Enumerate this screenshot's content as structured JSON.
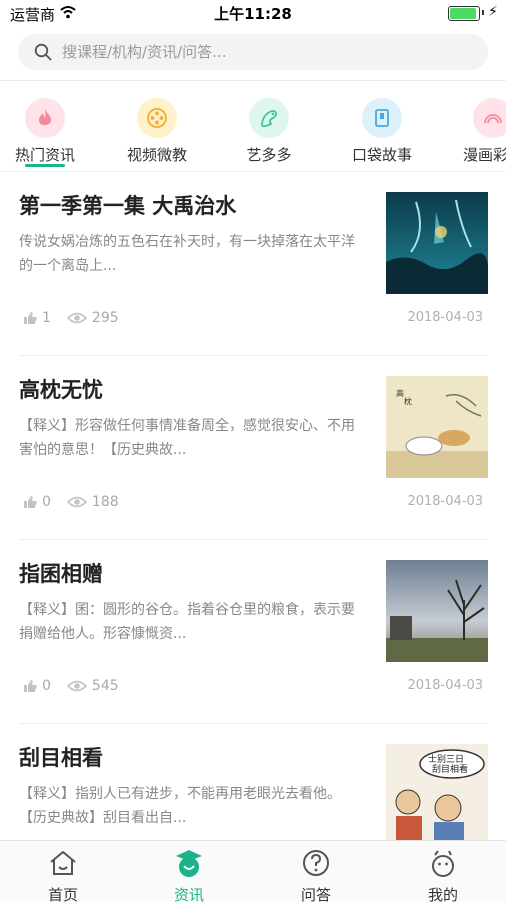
{
  "status_bar": {
    "carrier": "运营商",
    "time": "上午11:28"
  },
  "search": {
    "placeholder": "搜课程/机构/资讯/问答..."
  },
  "categories": [
    {
      "label": "热门资讯",
      "icon": "flame-icon",
      "color": "#ffe3e8",
      "active": true
    },
    {
      "label": "视频微教",
      "icon": "film-reel-icon",
      "color": "#fff1c9"
    },
    {
      "label": "艺多多",
      "icon": "palette-icon",
      "color": "#dff6ee"
    },
    {
      "label": "口袋故事",
      "icon": "book-icon",
      "color": "#ddf1fb"
    },
    {
      "label": "漫画彩虹",
      "icon": "rainbow-icon",
      "color": "#ffe3e8"
    }
  ],
  "articles": [
    {
      "title": "第一季第一集 大禹治水",
      "desc": "传说女娲冶炼的五色石在补天时，有一块掉落在太平洋的一个离岛上...",
      "likes": "1",
      "views": "295",
      "date": "2018-04-03"
    },
    {
      "title": "高枕无忧",
      "desc": "【释义】形容做任何事情准备周全，感觉很安心、不用害怕的意思！【历史典故...",
      "likes": "0",
      "views": "188",
      "date": "2018-04-03"
    },
    {
      "title": "指囷相赠",
      "desc": "【释义】囷：圆形的谷仓。指着谷仓里的粮食，表示要捐赠给他人。形容慷慨资...",
      "likes": "0",
      "views": "545",
      "date": "2018-04-03"
    },
    {
      "title": "刮目相看",
      "desc": "【释义】指别人已有进步，不能再用老眼光去看他。【历史典故】刮目看出自...",
      "likes": "",
      "views": "",
      "date": ""
    }
  ],
  "tabs": [
    {
      "label": "首页",
      "icon": "home-icon"
    },
    {
      "label": "资讯",
      "icon": "news-icon",
      "active": true
    },
    {
      "label": "问答",
      "icon": "question-icon"
    },
    {
      "label": "我的",
      "icon": "profile-icon"
    }
  ],
  "colors": {
    "accent": "#1bb38a"
  }
}
